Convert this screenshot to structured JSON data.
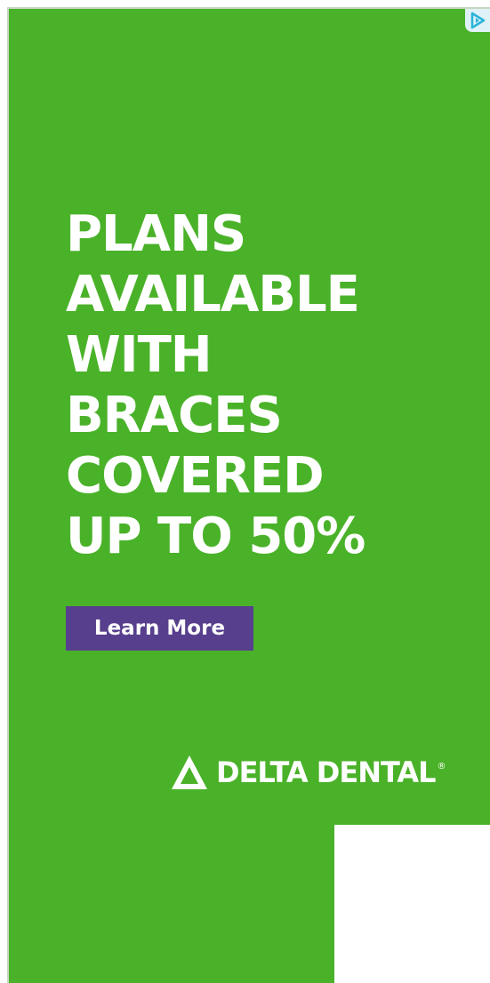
{
  "ad": {
    "headline_lines": [
      "PLANS",
      "AVAILABLE",
      "WITH",
      "BRACES",
      "COVERED",
      "UP TO 50%"
    ],
    "cta_label": "Learn More",
    "brand_name": "DELTA DENTAL",
    "registered_mark": "®",
    "ad_choices_icon": "ad-choices-icon"
  },
  "colors": {
    "background": "#4ab229",
    "cta_background": "#573f8d",
    "text": "#ffffff",
    "ad_choices": "#2bb3d9"
  }
}
